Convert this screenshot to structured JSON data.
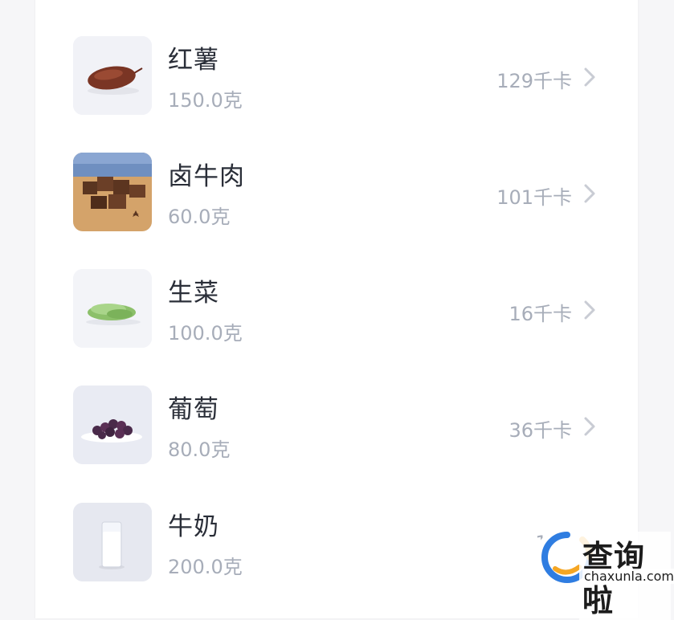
{
  "food_list": {
    "items": [
      {
        "name": "红薯",
        "amount": "150.0克",
        "calories": "129千卡",
        "icon": "sweet-potato-icon"
      },
      {
        "name": "卤牛肉",
        "amount": "60.0克",
        "calories": "101千卡",
        "icon": "braised-beef-icon"
      },
      {
        "name": "生菜",
        "amount": "100.0克",
        "calories": "16千卡",
        "icon": "lettuce-icon"
      },
      {
        "name": "葡萄",
        "amount": "80.0克",
        "calories": "36千卡",
        "icon": "grapes-icon"
      },
      {
        "name": "牛奶",
        "amount": "200.0克",
        "calories": "130",
        "icon": "milk-icon"
      }
    ],
    "chevron_icon": "chevron-right-icon"
  },
  "watermark": {
    "title": "查询啦",
    "url": "chaxunla.com",
    "colors": {
      "blue": "#2f7de1",
      "orange": "#f5a623"
    }
  }
}
